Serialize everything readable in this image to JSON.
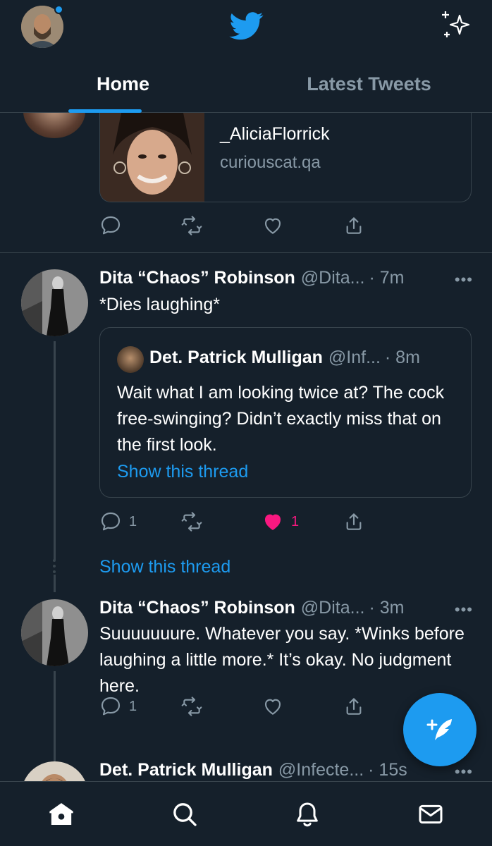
{
  "header": {
    "tabs": [
      {
        "label": "Home",
        "active": true
      },
      {
        "label": "Latest Tweets",
        "active": false
      }
    ],
    "notification_dot": true
  },
  "link_card": {
    "title": "_AliciaFlorrick",
    "domain": "curiouscat.qa"
  },
  "tweets": [
    {
      "name": "Dita “Chaos” Robinson",
      "handle": "@Dita...",
      "time": "· 7m",
      "more": "•••",
      "text": "*Dies laughing*",
      "quote": {
        "name": "Det. Patrick Mulligan",
        "handle": "@Inf...",
        "time": "· 8m",
        "text": "Wait what I am looking twice at? The cock free-swinging? Didn’t exactly miss that on the first look.",
        "link": "Show this thread"
      },
      "reply_count": "1",
      "like_count": "1",
      "liked": true
    },
    {
      "name": "Dita “Chaos” Robinson",
      "handle": "@Dita...",
      "time": "· 3m",
      "more": "•••",
      "text": "Suuuuuuure. Whatever you say. *Winks before laughing a little more.* It’s okay. No judgment here.",
      "reply_count": "1"
    },
    {
      "name": "Det. Patrick Mulligan",
      "handle": "@Infecte...",
      "time": "· 15s",
      "more": "•••"
    }
  ],
  "show_thread_link": "Show this thread",
  "icons": {
    "logo": "twitter-bird-icon",
    "sparkle": "sparkle-icon",
    "reply": "reply-icon",
    "retweet": "retweet-icon",
    "like": "heart-icon",
    "share": "share-icon",
    "compose": "compose-tweet-icon",
    "nav": [
      "home-icon",
      "search-icon",
      "notifications-icon",
      "messages-icon"
    ]
  },
  "colors": {
    "background": "#15202b",
    "accent": "#1d9bf0",
    "secondary_text": "#8899a6",
    "border": "#38444d",
    "like": "#f91880"
  }
}
